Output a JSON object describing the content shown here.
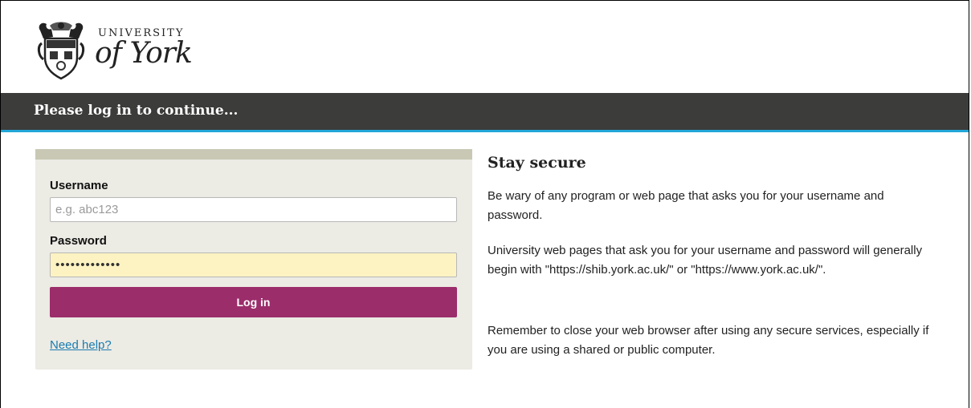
{
  "logo": {
    "line1": "UNIVERSITY",
    "line2": "of York"
  },
  "header": {
    "title": "Please log in to continue..."
  },
  "login": {
    "username_label": "Username",
    "username_placeholder": "e.g. abc123",
    "username_value": "",
    "password_label": "Password",
    "password_value": "•••••••••••••",
    "submit_label": "Log in",
    "help_link": "Need help?"
  },
  "security": {
    "title": "Stay secure",
    "para1": "Be wary of any program or web page that asks you for your username and password.",
    "para2": "University web pages that ask you for your username and password will generally begin with \"https://shib.york.ac.uk/\" or \"https://www.york.ac.uk/\".",
    "para3": "Remember to close your web browser after using any secure services, especially if you are using a shared or public computer."
  },
  "colors": {
    "header_bg": "#3c3c3b",
    "header_accent": "#22a7d9",
    "button_bg": "#9b2d6b",
    "panel_bg": "#ecebe4",
    "link": "#1a7cb0",
    "autofill_bg": "#fdf3c2"
  }
}
